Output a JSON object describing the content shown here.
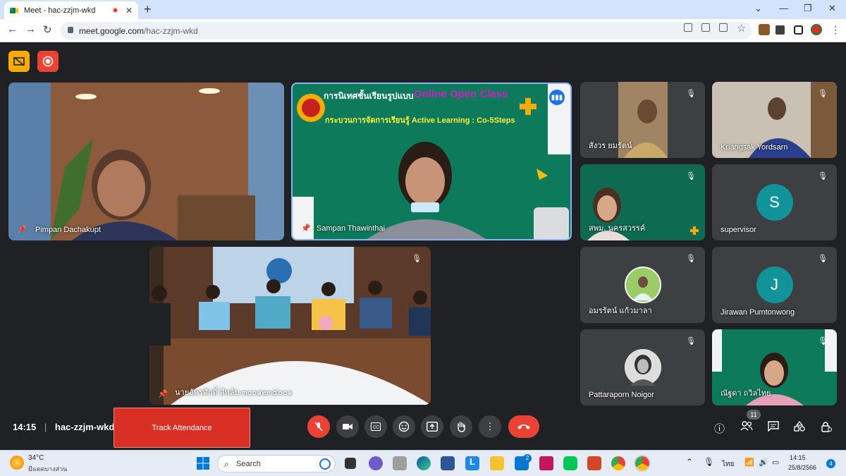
{
  "browser": {
    "tab_title": "Meet - hac-zzjm-wkd",
    "url_host": "meet.google.com",
    "url_path": "/hac-zzjm-wkd"
  },
  "meeting": {
    "time": "14:15",
    "code": "hac-zzjm-wkd",
    "participant_count": "11",
    "track_attendance_label": "Track Attendance"
  },
  "slide": {
    "title_thai": "การนิเทศชั้นเรียนรูปแบบ",
    "title_en": "Online Open Class",
    "process": "กระบวนการจัดการเรียนรู้ Active Learning : Co-5Steps"
  },
  "participants": [
    {
      "name": "Pimpan Dachakupt"
    },
    {
      "name": "Sampan Thawinthai"
    },
    {
      "name": "นายอัครศักดิ์ สีหลับ-๓๐๐๑๒๓๕๐๐๑"
    },
    {
      "name": "สังวร ยมรัตน์"
    },
    {
      "name": "Kriangsak Yordsarn"
    },
    {
      "name": "สพม. นครสวรรค์"
    },
    {
      "name": "supervisor",
      "initial": "S"
    },
    {
      "name": "อมรรัตน์ แก้วมาลา"
    },
    {
      "name": "Jirawan Pumtonwong",
      "initial": "J"
    },
    {
      "name": "Pattaraporn Noigor"
    },
    {
      "name": "ณัฐดา ถวิลไทย"
    }
  ],
  "taskbar": {
    "weather_temp": "34°C",
    "weather_desc": "มีแดดบางส่วน",
    "search_label": "Search",
    "lang": "ไทย",
    "clock_time": "14:15",
    "clock_date": "25/8/2566",
    "notif_count": "4",
    "mail_badge": "2"
  },
  "colors": {
    "meet_bg": "#202124",
    "end_call": "#ea4335",
    "active_speaker": "#8ab4f8",
    "avatar_teal": "#12939a"
  }
}
